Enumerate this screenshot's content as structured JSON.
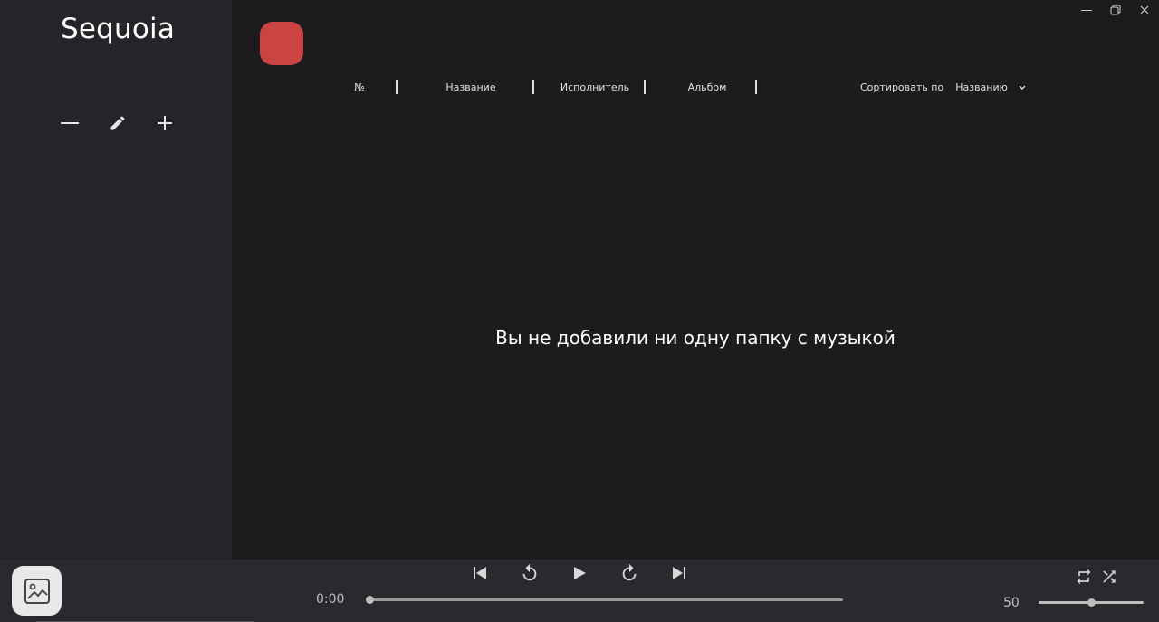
{
  "app": {
    "title": "Sequoia"
  },
  "sidebar": {
    "actions": [
      {
        "name": "remove-playlist-button",
        "icon": "minus-icon"
      },
      {
        "name": "edit-playlist-button",
        "icon": "pencil-icon"
      },
      {
        "name": "add-playlist-button",
        "icon": "plus-icon"
      }
    ]
  },
  "main": {
    "folder_button_color": "#cc4343",
    "columns": [
      "№",
      "Название",
      "Исполнитель",
      "Альбом"
    ],
    "sort": {
      "label": "Сортировать по",
      "value": "Названию"
    },
    "empty_message": "Вы не добавили ни одну папку с музыкой"
  },
  "window_controls": [
    "minimize-icon",
    "restore-icon",
    "close-icon"
  ],
  "player": {
    "time": "0:00",
    "progress": 0,
    "volume": 50,
    "controls": [
      "skip-previous-icon",
      "rewind-icon",
      "play-icon",
      "forward-icon",
      "skip-next-icon"
    ],
    "modes": [
      "repeat-icon",
      "shuffle-icon"
    ]
  }
}
